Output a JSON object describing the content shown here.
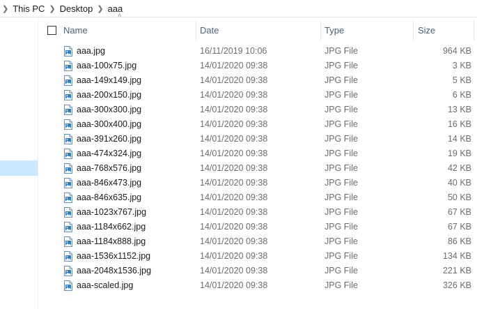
{
  "breadcrumb": {
    "items": [
      "This PC",
      "Desktop",
      "aaa"
    ]
  },
  "columns": {
    "name": "Name",
    "date": "Date",
    "type": "Type",
    "size": "Size"
  },
  "sort": {
    "column": "name",
    "icon": "chevron-up-icon"
  },
  "colors": {
    "selection": "#cce8ff",
    "header_text": "#4c607a",
    "icon_blue": "#2b7cd3"
  },
  "files": [
    {
      "name": "aaa.jpg",
      "date": "16/11/2019 10:06",
      "type": "JPG File",
      "size": "964 KB"
    },
    {
      "name": "aaa-100x75.jpg",
      "date": "14/01/2020 09:38",
      "type": "JPG File",
      "size": "3 KB"
    },
    {
      "name": "aaa-149x149.jpg",
      "date": "14/01/2020 09:38",
      "type": "JPG File",
      "size": "5 KB"
    },
    {
      "name": "aaa-200x150.jpg",
      "date": "14/01/2020 09:38",
      "type": "JPG File",
      "size": "6 KB"
    },
    {
      "name": "aaa-300x300.jpg",
      "date": "14/01/2020 09:38",
      "type": "JPG File",
      "size": "13 KB"
    },
    {
      "name": "aaa-300x400.jpg",
      "date": "14/01/2020 09:38",
      "type": "JPG File",
      "size": "16 KB"
    },
    {
      "name": "aaa-391x260.jpg",
      "date": "14/01/2020 09:38",
      "type": "JPG File",
      "size": "14 KB"
    },
    {
      "name": "aaa-474x324.jpg",
      "date": "14/01/2020 09:38",
      "type": "JPG File",
      "size": "19 KB"
    },
    {
      "name": "aaa-768x576.jpg",
      "date": "14/01/2020 09:38",
      "type": "JPG File",
      "size": "42 KB"
    },
    {
      "name": "aaa-846x473.jpg",
      "date": "14/01/2020 09:38",
      "type": "JPG File",
      "size": "40 KB"
    },
    {
      "name": "aaa-846x635.jpg",
      "date": "14/01/2020 09:38",
      "type": "JPG File",
      "size": "50 KB"
    },
    {
      "name": "aaa-1023x767.jpg",
      "date": "14/01/2020 09:38",
      "type": "JPG File",
      "size": "67 KB"
    },
    {
      "name": "aaa-1184x662.jpg",
      "date": "14/01/2020 09:38",
      "type": "JPG File",
      "size": "67 KB"
    },
    {
      "name": "aaa-1184x888.jpg",
      "date": "14/01/2020 09:38",
      "type": "JPG File",
      "size": "86 KB"
    },
    {
      "name": "aaa-1536x1152.jpg",
      "date": "14/01/2020 09:38",
      "type": "JPG File",
      "size": "134 KB"
    },
    {
      "name": "aaa-2048x1536.jpg",
      "date": "14/01/2020 09:38",
      "type": "JPG File",
      "size": "221 KB"
    },
    {
      "name": "aaa-scaled.jpg",
      "date": "14/01/2020 09:38",
      "type": "JPG File",
      "size": "326 KB"
    }
  ]
}
